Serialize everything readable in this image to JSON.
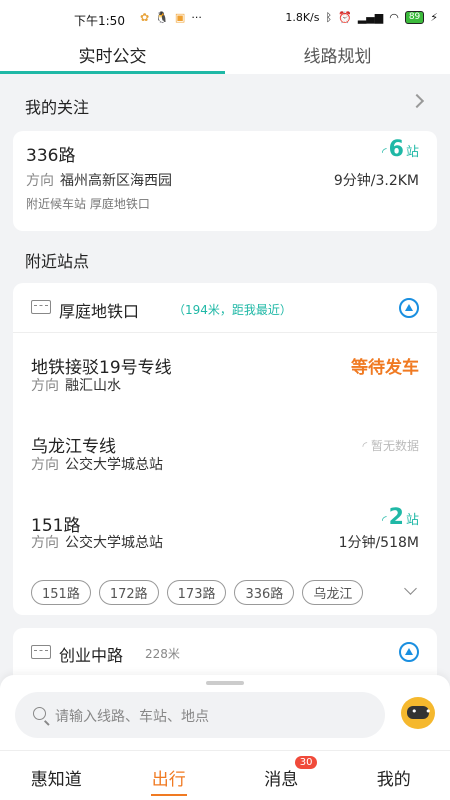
{
  "status": {
    "time": "下午1:50",
    "net_speed": "1.8K/s",
    "battery": "89",
    "more": "···"
  },
  "tabs": [
    {
      "label": "实时公交"
    },
    {
      "label": "线路规划"
    }
  ],
  "favorites": {
    "title": "我的关注",
    "item": {
      "route": "336路",
      "dir_label": "方向",
      "direction": "福州高新区海西园",
      "stops": "6",
      "stops_unit": "站",
      "eta": "9分钟/3.2KM",
      "nearby_label": "附近候车站",
      "nearby_stop": "厚庭地铁口"
    }
  },
  "nearby": {
    "title": "附近站点",
    "stop1": {
      "name": "厚庭地铁口",
      "dist": "（194米，距我最近）",
      "routes": [
        {
          "name": "地铁接驳19号专线",
          "dir_label": "方向",
          "direction": "融汇山水",
          "status": "等待发车"
        },
        {
          "name": "乌龙江专线",
          "dir_label": "方向",
          "direction": "公交大学城总站",
          "status": "暂无数据"
        },
        {
          "name": "151路",
          "dir_label": "方向",
          "direction": "公交大学城总站",
          "stops": "2",
          "stops_unit": "站",
          "eta": "1分钟/518M"
        }
      ],
      "chips": [
        "151路",
        "172路",
        "173路",
        "336路",
        "乌龙江"
      ]
    },
    "stop2": {
      "name": "创业中路",
      "dist": "228米"
    }
  },
  "search": {
    "placeholder": "请输入线路、车站、地点"
  },
  "bottom_nav": [
    {
      "label": "惠知道"
    },
    {
      "label": "出行"
    },
    {
      "label": "消息",
      "badge": "30"
    },
    {
      "label": "我的"
    }
  ],
  "colors": {
    "accent": "#1fb8a6",
    "orange": "#f07a22",
    "nav_blue": "#1a8fe0"
  }
}
